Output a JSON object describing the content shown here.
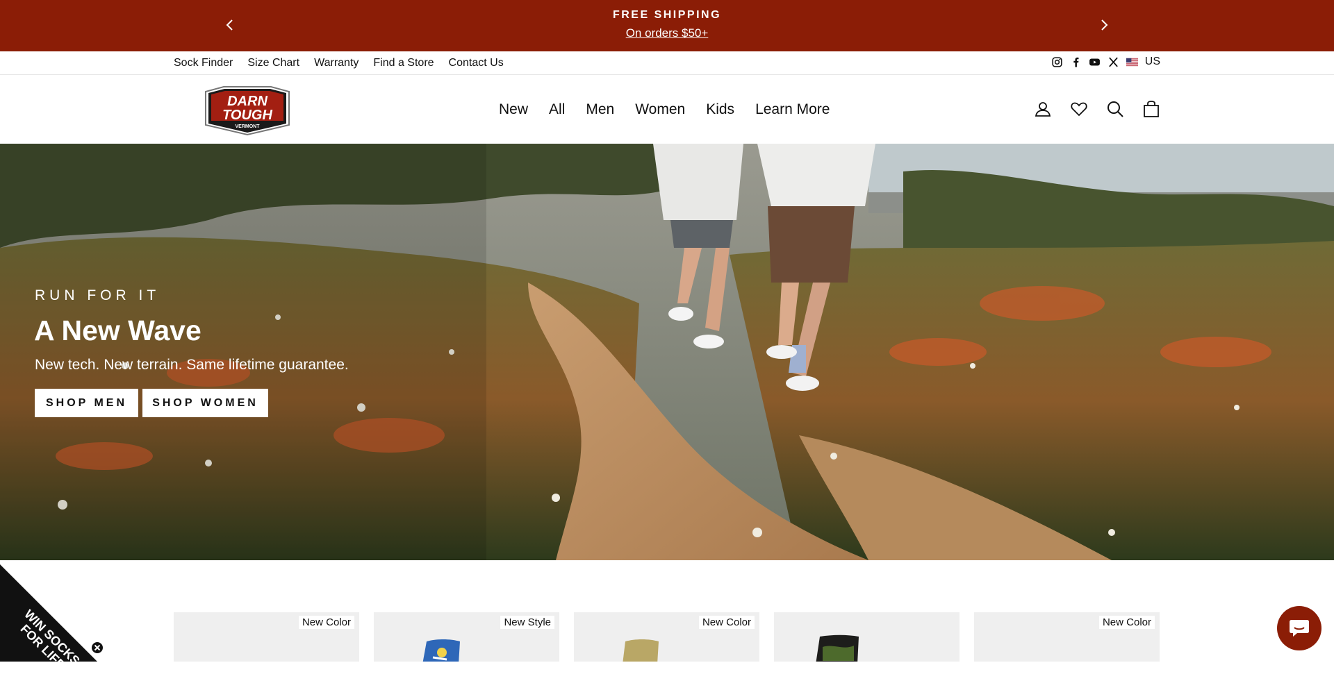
{
  "announcement": {
    "title": "FREE SHIPPING",
    "subtitle": "On orders $50+",
    "prev_icon": "chevron-left-icon",
    "next_icon": "chevron-right-icon",
    "background": "#8b1d06"
  },
  "utility_nav": {
    "links": [
      "Sock Finder",
      "Size Chart",
      "Warranty",
      "Find a Store",
      "Contact Us"
    ],
    "social_icons": [
      "instagram-icon",
      "facebook-icon",
      "youtube-icon",
      "x-icon"
    ],
    "region": "US"
  },
  "header": {
    "logo_text_1": "DARN",
    "logo_text_2": "TOUGH",
    "logo_text_3": "VERMONT",
    "nav": [
      "New",
      "All",
      "Men",
      "Women",
      "Kids",
      "Learn More"
    ],
    "icons": [
      "account-icon",
      "wishlist-icon",
      "search-icon",
      "cart-icon"
    ]
  },
  "hero": {
    "eyebrow": "RUN FOR IT",
    "title": "A New Wave",
    "subtitle": "New tech. New terrain. Same lifetime guarantee.",
    "buttons": [
      "SHOP MEN",
      "SHOP WOMEN"
    ]
  },
  "products": [
    {
      "badge": "New Color"
    },
    {
      "badge": "New Style"
    },
    {
      "badge": "New Color"
    },
    {
      "badge": ""
    },
    {
      "badge": "New Color"
    }
  ],
  "promo": {
    "text_line1": "WIN SOCKS",
    "text_line2": "FOR LIFE"
  },
  "colors": {
    "brand_red": "#8b1d06"
  }
}
